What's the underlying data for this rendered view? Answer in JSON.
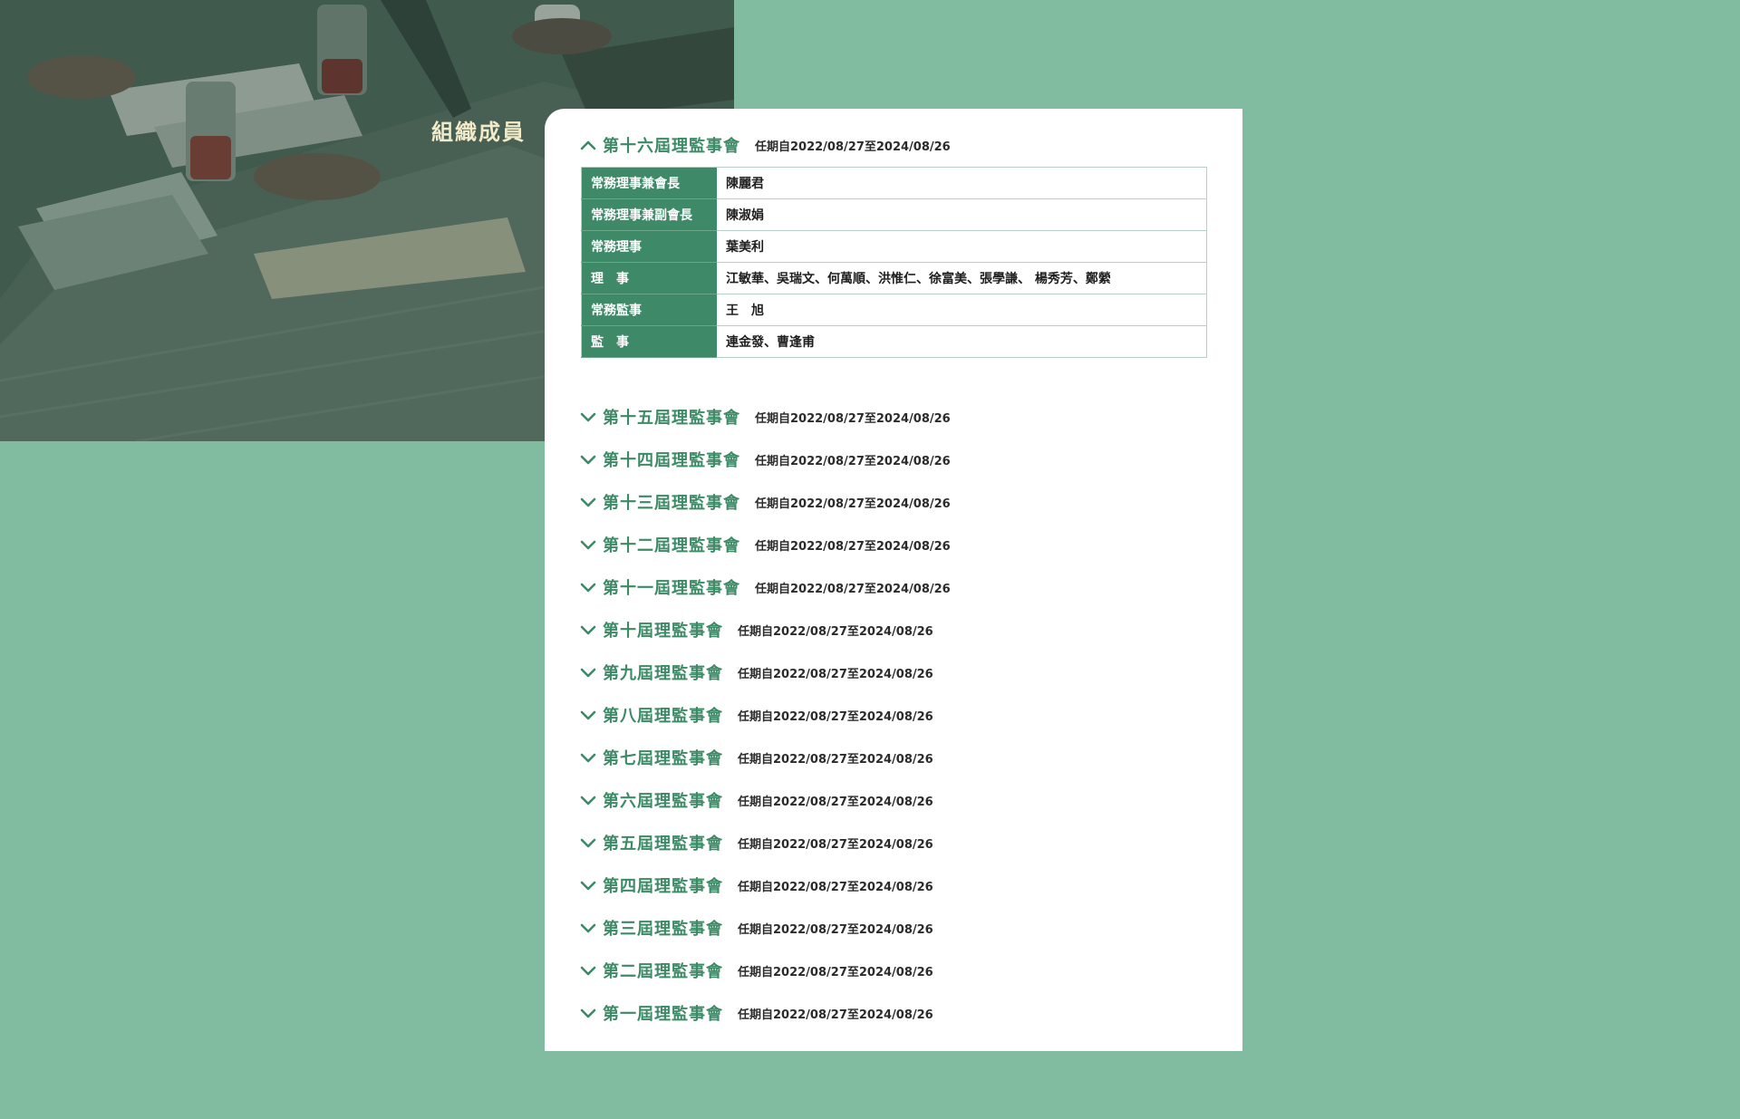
{
  "hero": {
    "title": "組織成員"
  },
  "colors": {
    "page_background": "#82bca0",
    "accent_green": "#3c8a66",
    "role_cell": "#3e8a68",
    "title_text": "#f2ebc9"
  },
  "current_term": {
    "name": "第十六屆理監事會",
    "period": "任期自2022/08/27至2024/08/26",
    "expanded": true,
    "icon": "chevron-up-icon",
    "members": [
      {
        "role": "常務理事兼會長",
        "names": "陳麗君"
      },
      {
        "role": "常務理事兼副會長",
        "names": "陳淑娟"
      },
      {
        "role": "常務理事",
        "names": "葉美利"
      },
      {
        "role": "理　事",
        "names": "江敏華、吳瑞文、何萬順、洪惟仁、徐富美、張學謙、 楊秀芳、鄭縈"
      },
      {
        "role": "常務監事",
        "names": "王　旭"
      },
      {
        "role": "監　事",
        "names": "連金發、曹逢甫"
      }
    ]
  },
  "past_terms": [
    {
      "name": "第十五屆理監事會",
      "period": "任期自2022/08/27至2024/08/26",
      "icon": "chevron-down-icon"
    },
    {
      "name": "第十四屆理監事會",
      "period": "任期自2022/08/27至2024/08/26",
      "icon": "chevron-down-icon"
    },
    {
      "name": "第十三屆理監事會",
      "period": "任期自2022/08/27至2024/08/26",
      "icon": "chevron-down-icon"
    },
    {
      "name": "第十二屆理監事會",
      "period": "任期自2022/08/27至2024/08/26",
      "icon": "chevron-down-icon"
    },
    {
      "name": "第十一屆理監事會",
      "period": "任期自2022/08/27至2024/08/26",
      "icon": "chevron-down-icon"
    },
    {
      "name": "第十屆理監事會",
      "period": "任期自2022/08/27至2024/08/26",
      "icon": "chevron-down-icon"
    },
    {
      "name": "第九屆理監事會",
      "period": "任期自2022/08/27至2024/08/26",
      "icon": "chevron-down-icon"
    },
    {
      "name": "第八屆理監事會",
      "period": "任期自2022/08/27至2024/08/26",
      "icon": "chevron-down-icon"
    },
    {
      "name": "第七屆理監事會",
      "period": "任期自2022/08/27至2024/08/26",
      "icon": "chevron-down-icon"
    },
    {
      "name": "第六屆理監事會",
      "period": "任期自2022/08/27至2024/08/26",
      "icon": "chevron-down-icon"
    },
    {
      "name": "第五屆理監事會",
      "period": "任期自2022/08/27至2024/08/26",
      "icon": "chevron-down-icon"
    },
    {
      "name": "第四屆理監事會",
      "period": "任期自2022/08/27至2024/08/26",
      "icon": "chevron-down-icon"
    },
    {
      "name": "第三屆理監事會",
      "period": "任期自2022/08/27至2024/08/26",
      "icon": "chevron-down-icon"
    },
    {
      "name": "第二屆理監事會",
      "period": "任期自2022/08/27至2024/08/26",
      "icon": "chevron-down-icon"
    },
    {
      "name": "第一屆理監事會",
      "period": "任期自2022/08/27至2024/08/26",
      "icon": "chevron-down-icon"
    }
  ]
}
